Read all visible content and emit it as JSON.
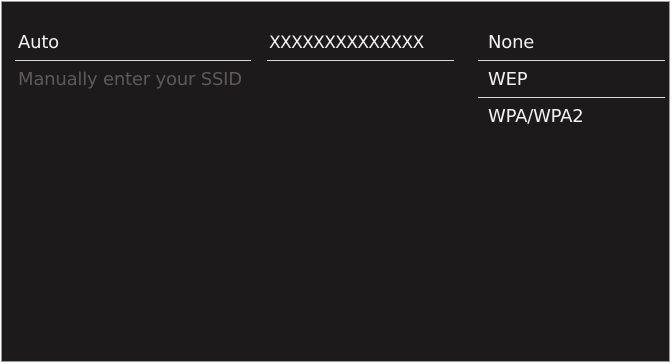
{
  "ssid_method": {
    "options": [
      {
        "label": "Auto"
      },
      {
        "label": "Manually enter your SSID"
      }
    ]
  },
  "network": {
    "ssid": "XXXXXXXXXXXXXX"
  },
  "security": {
    "options": [
      {
        "label": "None"
      },
      {
        "label": "WEP"
      },
      {
        "label": "WPA/WPA2"
      }
    ]
  },
  "colors": {
    "background": "#1c1a1a",
    "text": "#f2f2f2",
    "dim_text": "#5e5a5a",
    "divider": "#d8d8d8"
  }
}
